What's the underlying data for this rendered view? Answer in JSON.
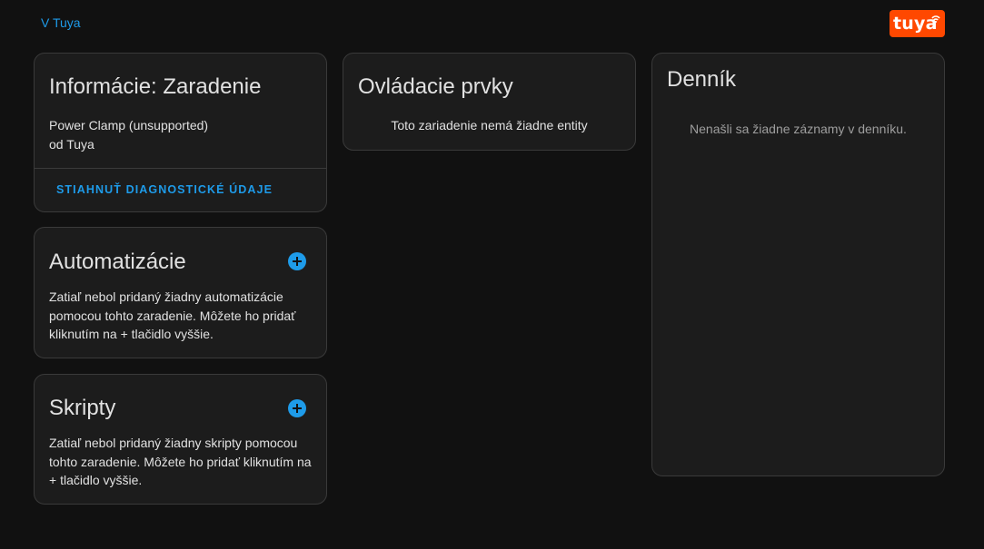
{
  "breadcrumb": {
    "label": "V Tuya"
  },
  "brand": {
    "name": "tuya",
    "icon": "wifi-icon",
    "color": "#ff4800"
  },
  "info_card": {
    "title": "Informácie: Zaradenie",
    "model": "Power Clamp (unsupported)",
    "manufacturer": "od Tuya",
    "action_label": "Stiahnuť diagnostické údaje"
  },
  "automations_card": {
    "title": "Automatizácie",
    "add_icon": "plus-circle-icon",
    "empty_text": "Zatiaľ nebol pridaný žiadny automatizácie pomocou tohto zaradenie. Môžete ho pridať kliknutím na + tlačidlo vyššie."
  },
  "scripts_card": {
    "title": "Skripty",
    "add_icon": "plus-circle-icon",
    "empty_text": "Zatiaľ nebol pridaný žiadny skripty pomocou tohto zaradenie. Môžete ho pridať kliknutím na + tlačidlo vyššie."
  },
  "controls_card": {
    "title": "Ovládacie prvky",
    "empty_text": "Toto zariadenie nemá žiadne entity"
  },
  "logbook_card": {
    "title": "Denník",
    "empty_text": "Nenašli sa žiadne záznamy v denníku."
  },
  "colors": {
    "background": "#111111",
    "card": "#1c1c1c",
    "accent": "#1e9be9",
    "text": "#e1e1e1",
    "muted_text": "#9e9e9e"
  }
}
